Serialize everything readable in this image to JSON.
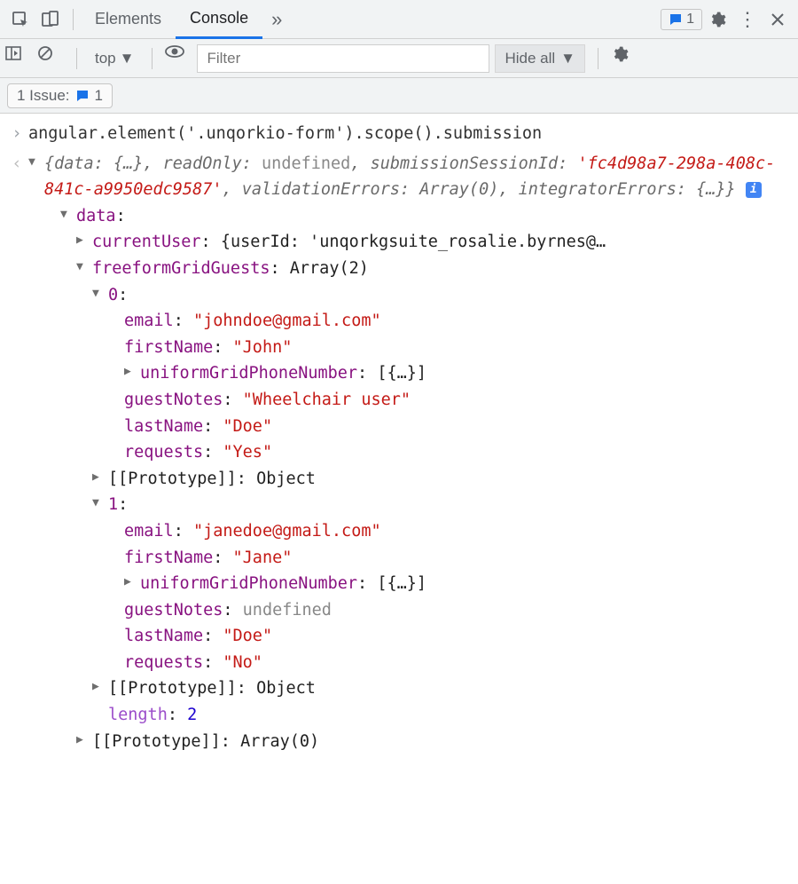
{
  "toolbar": {
    "tabs": {
      "elements": "Elements",
      "console": "Console"
    },
    "issue_count": "1"
  },
  "subbar": {
    "context": "top",
    "filter_placeholder": "Filter",
    "level": "Hide all"
  },
  "issues": {
    "label": "1 Issue:",
    "count": "1"
  },
  "console": {
    "command": "angular.element('.unqorkio-form').scope().submission",
    "summary_prefix": "{data: {…}, readOnly: ",
    "summary_readonly": "undefined",
    "summary_mid": ", submissionSessionId: ",
    "session_id": "'fc4d98a7-298a-408c-841c-a9950edc9587'",
    "summary_tail_a": ", validationErrors: Array(0), integratorErrors: {…}}",
    "data_label": "data",
    "currentUser_label": "currentUser",
    "currentUser_value": "{userId: 'unqorkgsuite_rosalie.byrnes@…",
    "guests_label": "freeformGridGuests",
    "guests_type": "Array(2)",
    "idx0": "0",
    "g0_email_k": "email",
    "g0_email_v": "\"johndoe@gmail.com\"",
    "g0_first_k": "firstName",
    "g0_first_v": "\"John\"",
    "g0_phone_k": "uniformGridPhoneNumber",
    "g0_phone_v": "[{…}]",
    "g0_notes_k": "guestNotes",
    "g0_notes_v": "\"Wheelchair user\"",
    "g0_last_k": "lastName",
    "g0_last_v": "\"Doe\"",
    "g0_req_k": "requests",
    "g0_req_v": "\"Yes\"",
    "proto_k": "[[Prototype]]",
    "proto_obj": "Object",
    "idx1": "1",
    "g1_email_v": "\"janedoe@gmail.com\"",
    "g1_first_v": "\"Jane\"",
    "g1_phone_v": "[{…}]",
    "g1_notes_v": "undefined",
    "g1_last_v": "\"Doe\"",
    "g1_req_v": "\"No\"",
    "length_k": "length",
    "length_v": "2",
    "proto_arr": "Array(0)"
  }
}
